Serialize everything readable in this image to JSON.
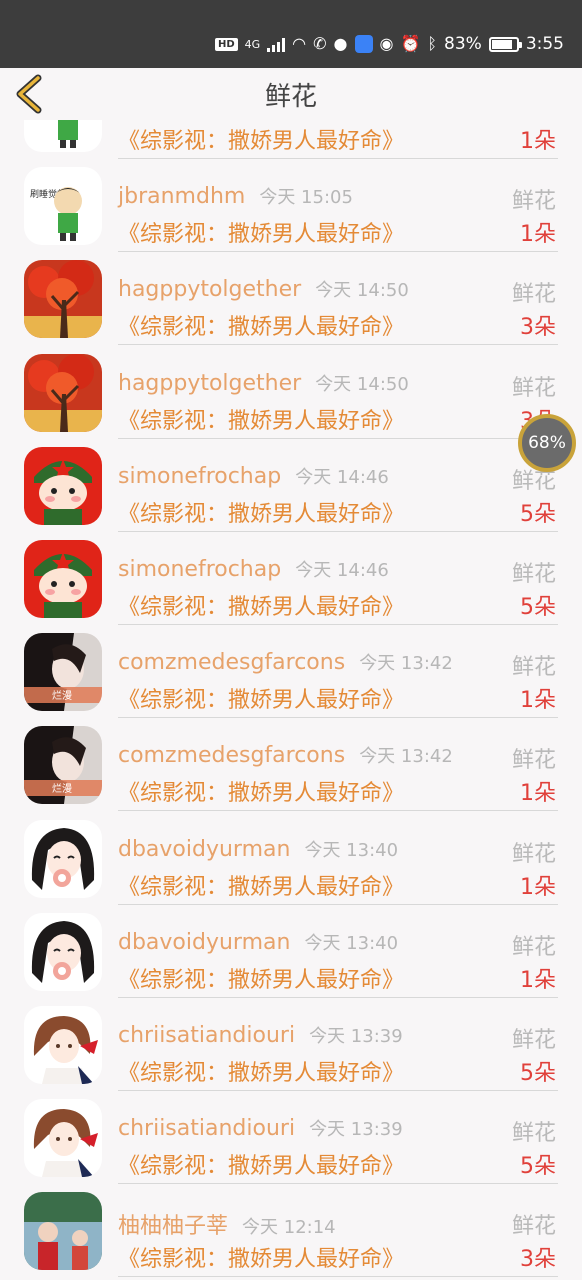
{
  "status": {
    "battery": "83%",
    "time": "3:55",
    "hd": "HD",
    "network": "4G",
    "battery_level": 0.83,
    "icons": [
      "hd-icon",
      "signal-icon",
      "wifi-icon",
      "phone-icon",
      "qq-icon",
      "app-icon",
      "eye-icon",
      "alarm-icon",
      "bluetooth-icon",
      "battery-icon"
    ]
  },
  "header": {
    "title": "鲜花",
    "back_icon": "chevron-left-icon"
  },
  "float_badge": {
    "label": "68%"
  },
  "colors": {
    "name": "#e7a26a",
    "book": "#e48a36",
    "count": "#e0403a",
    "accent": "#e8b53a"
  },
  "items": [
    {
      "name": "",
      "time": "",
      "gift": "",
      "book": "《综影视：撒娇男人最好命》",
      "count": "1朵",
      "avatar": "cartoon-kid"
    },
    {
      "name": "jbranmdhm",
      "time": "今天 15:05",
      "gift": "鲜花",
      "book": "《综影视：撒娇男人最好命》",
      "count": "1朵",
      "avatar": "cartoon-kid"
    },
    {
      "name": "hagppytolgether",
      "time": "今天 14:50",
      "gift": "鲜花",
      "book": "《综影视：撒娇男人最好命》",
      "count": "3朵",
      "avatar": "red-tree"
    },
    {
      "name": "hagppytolgether",
      "time": "今天 14:50",
      "gift": "鲜花",
      "book": "《综影视：撒娇男人最好命》",
      "count": "3朵",
      "avatar": "red-tree"
    },
    {
      "name": "simonefrochap",
      "time": "今天 14:46",
      "gift": "鲜花",
      "book": "《综影视：撒娇男人最好命》",
      "count": "5朵",
      "avatar": "soldier"
    },
    {
      "name": "simonefrochap",
      "time": "今天 14:46",
      "gift": "鲜花",
      "book": "《综影视：撒娇男人最好命》",
      "count": "5朵",
      "avatar": "soldier"
    },
    {
      "name": "comzmedesgfarcons",
      "time": "今天 13:42",
      "gift": "鲜花",
      "book": "《综影视：撒娇男人最好命》",
      "count": "1朵",
      "avatar": "girl-photo"
    },
    {
      "name": "comzmedesgfarcons",
      "time": "今天 13:42",
      "gift": "鲜花",
      "book": "《综影视：撒娇男人最好命》",
      "count": "1朵",
      "avatar": "girl-photo"
    },
    {
      "name": "dbavoidyurman",
      "time": "今天 13:40",
      "gift": "鲜花",
      "book": "《综影视：撒娇男人最好命》",
      "count": "1朵",
      "avatar": "anime-girl"
    },
    {
      "name": "dbavoidyurman",
      "time": "今天 13:40",
      "gift": "鲜花",
      "book": "《综影视：撒娇男人最好命》",
      "count": "1朵",
      "avatar": "anime-girl"
    },
    {
      "name": "chriisatiandiouri",
      "time": "今天 13:39",
      "gift": "鲜花",
      "book": "《综影视：撒娇男人最好命》",
      "count": "5朵",
      "avatar": "brown-hair"
    },
    {
      "name": "chriisatiandiouri",
      "time": "今天 13:39",
      "gift": "鲜花",
      "book": "《综影视：撒娇男人最好命》",
      "count": "5朵",
      "avatar": "brown-hair"
    },
    {
      "name": "柚柚柚子莘",
      "time": "今天 12:14",
      "gift": "鲜花",
      "book": "《综影视：撒娇男人最好命》",
      "count": "3朵",
      "avatar": "beach-photo"
    }
  ]
}
